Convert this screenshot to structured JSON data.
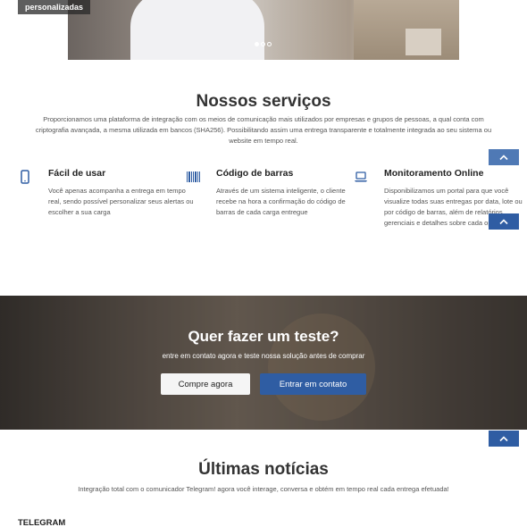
{
  "hero": {
    "caption": "personalizadas",
    "slides": [
      "slide-1",
      "slide-2",
      "slide-3"
    ],
    "active_slide": 1
  },
  "services": {
    "title": "Nossos serviços",
    "intro": "Proporcionamos uma plataforma de integração com os meios de comunicação mais utilizados por empresas e grupos de pessoas, a qual conta com criptografia avançada, a mesma utilizada em bancos (SHA256). Possibilitando assim uma entrega transparente e totalmente integrada ao seu sistema ou website em tempo real.",
    "features": [
      {
        "icon": "mobile-phone-icon",
        "title": "Fácil de usar",
        "text": "Você apenas acompanha a entrega em tempo real, sendo possível personalizar seus alertas ou escolher a sua carga"
      },
      {
        "icon": "barcode-icon",
        "title": "Código de barras",
        "text": "Através de um sistema inteligente, o cliente recebe na hora a confirmação do código de barras de cada carga entregue"
      },
      {
        "icon": "laptop-icon",
        "title": "Monitoramento Online",
        "text": "Disponibilizamos um portal para que você visualize todas suas entregas por data, lote ou por código de barras, além de relatórios gerenciais e detalhes sobre cada operação"
      }
    ]
  },
  "cta": {
    "title": "Quer fazer um teste?",
    "subtitle": "entre em contato agora e teste nossa solução antes de comprar",
    "buy_label": "Compre agora",
    "contact_label": "Entrar em contato"
  },
  "news": {
    "title": "Últimas notícias",
    "subtitle": "Integração total com o comunicador Telegram! agora você interage, conversa e obtém em tempo real cada entrega efetuada!",
    "first_item": "TELEGRAM"
  },
  "colors": {
    "accent": "#2f5da3",
    "back_to_top": "#4f79b5",
    "icon": "#2f5da3"
  }
}
